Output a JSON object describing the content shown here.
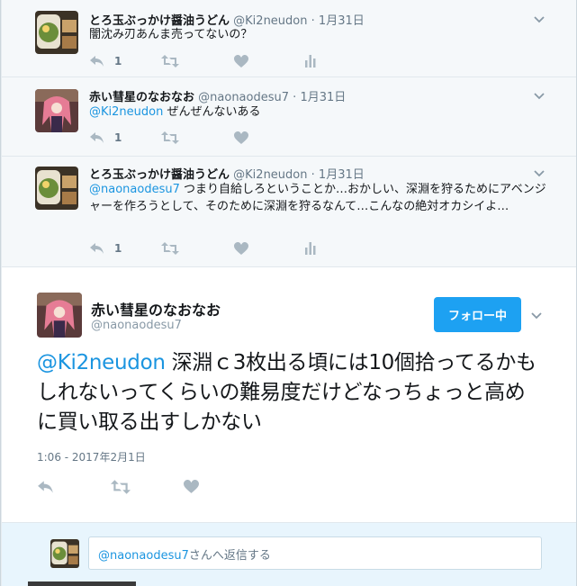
{
  "colors": {
    "accent": "#1da1f2",
    "mention": "#1b95e0",
    "muted": "#657786",
    "context_bg": "#f5f8fa",
    "reply_bg": "#e8f5fd"
  },
  "context_tweets": [
    {
      "name": "とろ玉ぶっかけ醤油うどん",
      "handle": "@Ki2neudon",
      "dot": "·",
      "time": "1月31日",
      "mention": "",
      "text": "闇沈み刃あんま売ってないの？",
      "reply_count": "1",
      "avatar": "udon-food-photo"
    },
    {
      "name": "赤い彗星のなおなお",
      "handle": "@naonaodesu7",
      "dot": "·",
      "time": "1月31日",
      "mention": "@Ki2neudon",
      "text": " ぜんぜんないある",
      "reply_count": "1",
      "avatar": "anime-character"
    },
    {
      "name": "とろ玉ぶっかけ醤油うどん",
      "handle": "@Ki2neudon",
      "dot": "·",
      "time": "1月31日",
      "mention": "@naonaodesu7",
      "text": " つまり自給しろということか…おかしい、深淵を狩るためにアベンジャーを作ろうとして、そのために深淵を狩るなんて…こんなの絶対オカシイよ…",
      "reply_count": "1",
      "avatar": "udon-food-photo"
    }
  ],
  "main_tweet": {
    "name": "赤い彗星のなおなお",
    "handle": "@naonaodesu7",
    "follow_label": "フォロー中",
    "mention": "@Ki2neudon",
    "text": " 深淵ｃ3枚出る頃には10個拾ってるかもしれないってくらいの難易度だけどなっちょっと高めに買い取る出すしかない",
    "timestamp": "1:06 - 2017年2月1日"
  },
  "reply_box": {
    "mention": "@naonaodesu7",
    "placeholder_suffix": "さんへ返信する"
  }
}
